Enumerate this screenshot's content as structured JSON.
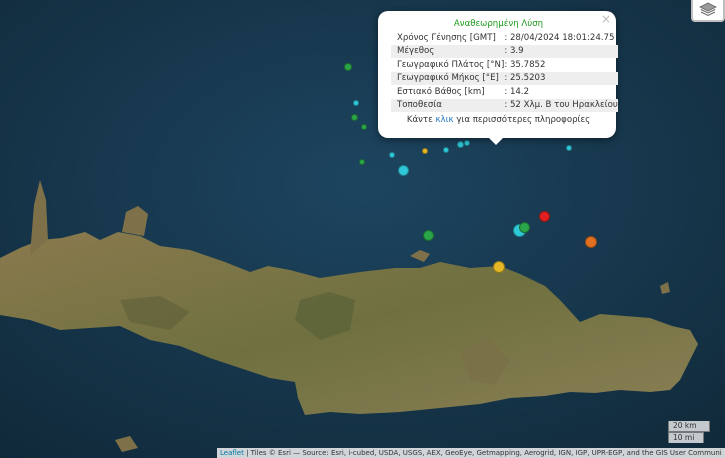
{
  "popup": {
    "title": "Αναθεωρημένη Λύση",
    "close": "×",
    "rows": [
      {
        "label": "Χρόνος Γένησης [GMT]",
        "value": ": 28/04/2024 18:01:24.75"
      },
      {
        "label": "Μέγεθος",
        "value": ": 3.9"
      },
      {
        "label": "Γεωγραφικό Πλάτος [°N]",
        "value": ": 35.7852"
      },
      {
        "label": "Γεωγραφικό Μήκος [°E]",
        "value": ": 25.5203"
      },
      {
        "label": "Εστιακό Βάθος [km]",
        "value": ": 14.2"
      },
      {
        "label": "Τοποθεσία",
        "value": ": 52 Χλμ. Β του Ηρακλείου"
      }
    ],
    "more_prefix": "Κάντε ",
    "more_link": "κλικ",
    "more_suffix": " για περισσότερες πληροφορίες"
  },
  "layers_control": {
    "icon": "layers-icon"
  },
  "scale": {
    "km": "20 km",
    "mi": "10 mi"
  },
  "attribution": {
    "leaflet": "Leaflet",
    "text": " | Tiles © Esri — Source: Esri, i-cubed, USDA, USGS, AEX, GeoEye, Getmapping, Aerogrid, IGN, IGP, UPR-EGP, and the GIS User Communi"
  },
  "marker_colors": {
    "cyan": "#2ec8d8",
    "green": "#2aa648",
    "yellow": "#e4b825",
    "orange": "#e07020",
    "red": "#e02020"
  }
}
